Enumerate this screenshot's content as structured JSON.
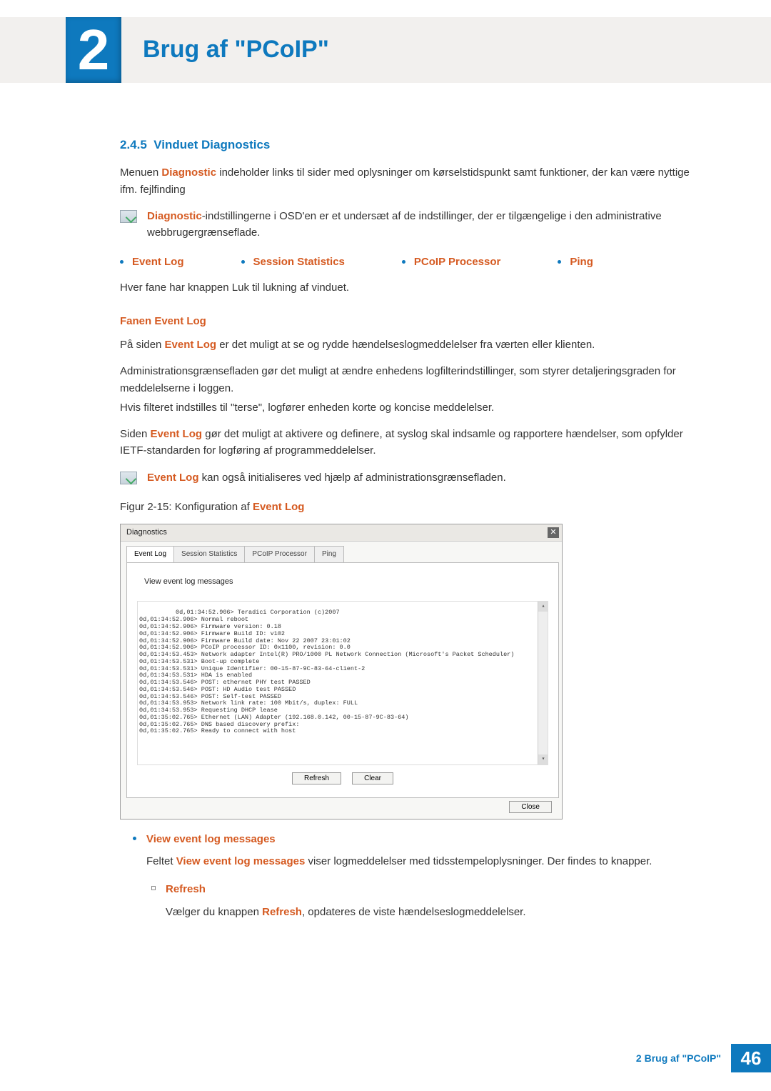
{
  "header": {
    "chapter_number": "2",
    "title": "Brug af \"PCoIP\""
  },
  "section": {
    "number": "2.4.5",
    "title": "Vinduet Diagnostics",
    "intro_pre": "Menuen ",
    "intro_emph": "Diagnostic",
    "intro_post": " indeholder links til sider med oplysninger om kørselstidspunkt samt funktioner, der kan være nyttige ifm. fejlfinding",
    "info_emph": "Diagnostic",
    "info_post": "-indstillingerne i OSD'en er et undersæt af de indstillinger, der er tilgængelige i den administrative webbrugergrænseflade.",
    "tabs": [
      "Event Log",
      "Session Statistics",
      "PCoIP Processor",
      "Ping"
    ],
    "each_tab_has_close": "Hver fane har knappen Luk til lukning af vinduet."
  },
  "event_log_section": {
    "heading": "Fanen Event Log",
    "p1_pre": "På siden ",
    "p1_emph": "Event Log",
    "p1_post": " er det muligt at se og rydde hændelseslogmeddelelser fra værten eller klienten.",
    "p2": "Administrationsgrænsefladen gør det muligt at ændre enhedens logfilterindstillinger, som styrer detaljeringsgraden for meddelelserne i loggen.",
    "p3": "Hvis filteret indstilles til \"terse\", logfører enheden korte og koncise meddelelser.",
    "p4_pre": "Siden ",
    "p4_emph": "Event Log",
    "p4_post": " gør det muligt at aktivere og definere, at syslog skal indsamle og rapportere hændelser, som opfylder IETF-standarden for logføring af programmeddelelser.",
    "info_emph": "Event Log",
    "info_post": " kan også initialiseres ved hjælp af administrationsgrænsefladen.",
    "fig_pre": "Figur 2-15: Konfiguration af ",
    "fig_emph": "Event Log"
  },
  "dialog": {
    "title": "Diagnostics",
    "tabs": [
      "Event Log",
      "Session Statistics",
      "PCoIP Processor",
      "Ping"
    ],
    "active_tab_index": 0,
    "subtitle": "View event log messages",
    "log_lines": "0d,01:34:52.906> Teradici Corporation (c)2007\n0d,01:34:52.906> Normal reboot\n0d,01:34:52.906> Firmware version: 0.18\n0d,01:34:52.906> Firmware Build ID: v102\n0d,01:34:52.906> Firmware Build date: Nov 22 2007 23:01:02\n0d,01:34:52.906> PCoIP processor ID: 0x1100, revision: 0.0\n0d,01:34:53.453> Network adapter Intel(R) PRO/1000 PL Network Connection (Microsoft's Packet Scheduler)\n0d,01:34:53.531> Boot-up complete\n0d,01:34:53.531> Unique Identifier: 00-15-87-9C-83-64-client-2\n0d,01:34:53.531> HDA is enabled\n0d,01:34:53.546> POST: ethernet PHY test PASSED\n0d,01:34:53.546> POST: HD Audio test PASSED\n0d,01:34:53.546> POST: Self-test PASSED\n0d,01:34:53.953> Network link rate: 100 Mbit/s, duplex: FULL\n0d,01:34:53.953> Requesting DHCP lease\n0d,01:35:02.765> Ethernet (LAN) Adapter (192.168.0.142, 00-15-87-9C-83-64)\n0d,01:35:02.765> DNS based discovery prefix:\n0d,01:35:02.765> Ready to connect with host",
    "btn_refresh": "Refresh",
    "btn_clear": "Clear",
    "btn_close": "Close"
  },
  "below": {
    "b1_label": "View event log messages",
    "b1_p_pre": "Feltet ",
    "b1_p_emph": "View event log messages",
    "b1_p_post": " viser logmeddelelser med tidsstempeloplysninger. Der findes to knapper.",
    "sb1_label": "Refresh",
    "sb1_p_pre": "Vælger du knappen ",
    "sb1_p_emph": "Refresh",
    "sb1_p_post": ", opdateres de viste hændelseslogmeddelelser."
  },
  "footer": {
    "text": "2 Brug af \"PCoIP\"",
    "page_number": "46"
  }
}
